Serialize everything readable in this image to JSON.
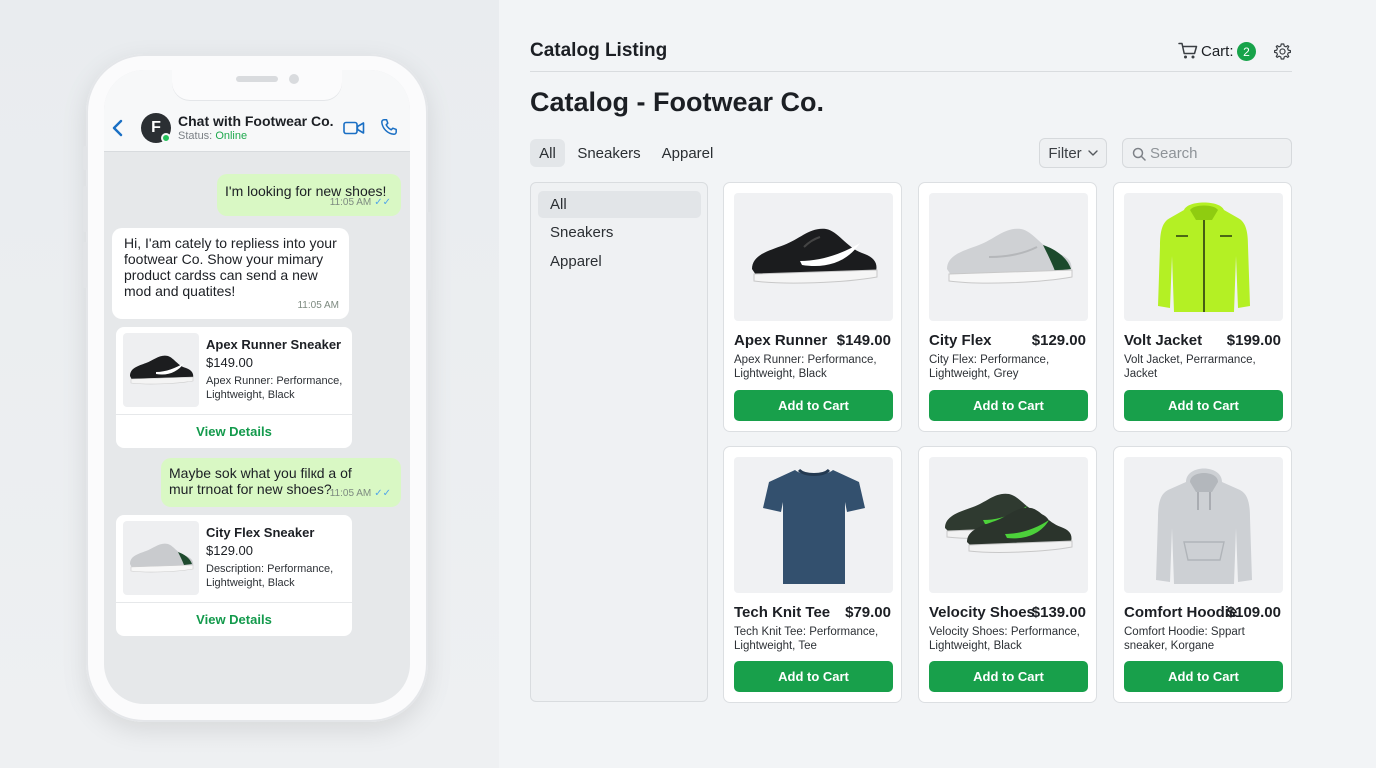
{
  "chat": {
    "avatar_initial": "F",
    "title": "Chat with Footwear Co.",
    "status_prefix": "Status:",
    "status_value": "Online",
    "messages": [
      {
        "direction": "out",
        "text": "I'm looking for new shoes!",
        "time": "11:05 AM",
        "ticks": "✓✓"
      },
      {
        "direction": "in",
        "text": "Hi, I'am cately to repliess into your footwear Co. Show your mimary product cardss can send a new mod and quatites!",
        "time": "11:05 AM"
      },
      {
        "direction": "out",
        "text": "Maybe sok what you filкd a of mur trnoat for new shoes?",
        "time": "11:05 AM",
        "ticks": "✓✓"
      }
    ],
    "product_cards": [
      {
        "name": "Apex Runner Sneaker",
        "price": "$149.00",
        "desc": "Apex Runner: Performance, Lightweight, Black",
        "link": "View Details"
      },
      {
        "name": "City Flex Sneaker",
        "price": "$129.00",
        "desc": "Description: Performance, Lightweight, Black",
        "link": "View Details"
      }
    ]
  },
  "catalog": {
    "topbar_title": "Catalog Listing",
    "cart_label": "Cart:",
    "cart_count": "2",
    "page_title": "Catalog - Footwear Co.",
    "tabs": [
      "All",
      "Sneakers",
      "Apparel"
    ],
    "filter_label": "Filter",
    "search_placeholder": "Search",
    "sidebar": [
      "All",
      "Sneakers",
      "Apparel"
    ],
    "add_label": "Add to Cart",
    "products": [
      {
        "name": "Apex Runner",
        "price": "$149.00",
        "desc": "Apex Runner: Performance, Lightweight, Black",
        "image": "black-sneaker"
      },
      {
        "name": "City Flex",
        "price": "$129.00",
        "desc": "City Flex: Performance, Lightweight, Grey",
        "image": "grey-sneaker"
      },
      {
        "name": "Volt Jacket",
        "price": "$199.00",
        "desc": "Volt Jacket, Perrarmance, Jacket",
        "image": "lime-jacket"
      },
      {
        "name": "Tech Knit Tee",
        "price": "$79.00",
        "desc": "Tech Knit Tee: Performance, Lightweight, Tee",
        "image": "navy-tshirt"
      },
      {
        "name": "Velocity Shoes",
        "price": "$139.00",
        "desc": "Velocity Shoes: Performance, Lightweight, Black",
        "image": "green-sneakers-pair"
      },
      {
        "name": "Comfort Hoodie",
        "price": "$109.00",
        "desc": "Comfort Hoodie: Sppart sneaker, Korgane",
        "image": "grey-hoodie"
      }
    ]
  },
  "colors": {
    "accent_green": "#18a04b",
    "outgoing_bubble": "#d9f8c4",
    "online_green": "#1fa94e",
    "link_blue": "#1a6fc4"
  }
}
